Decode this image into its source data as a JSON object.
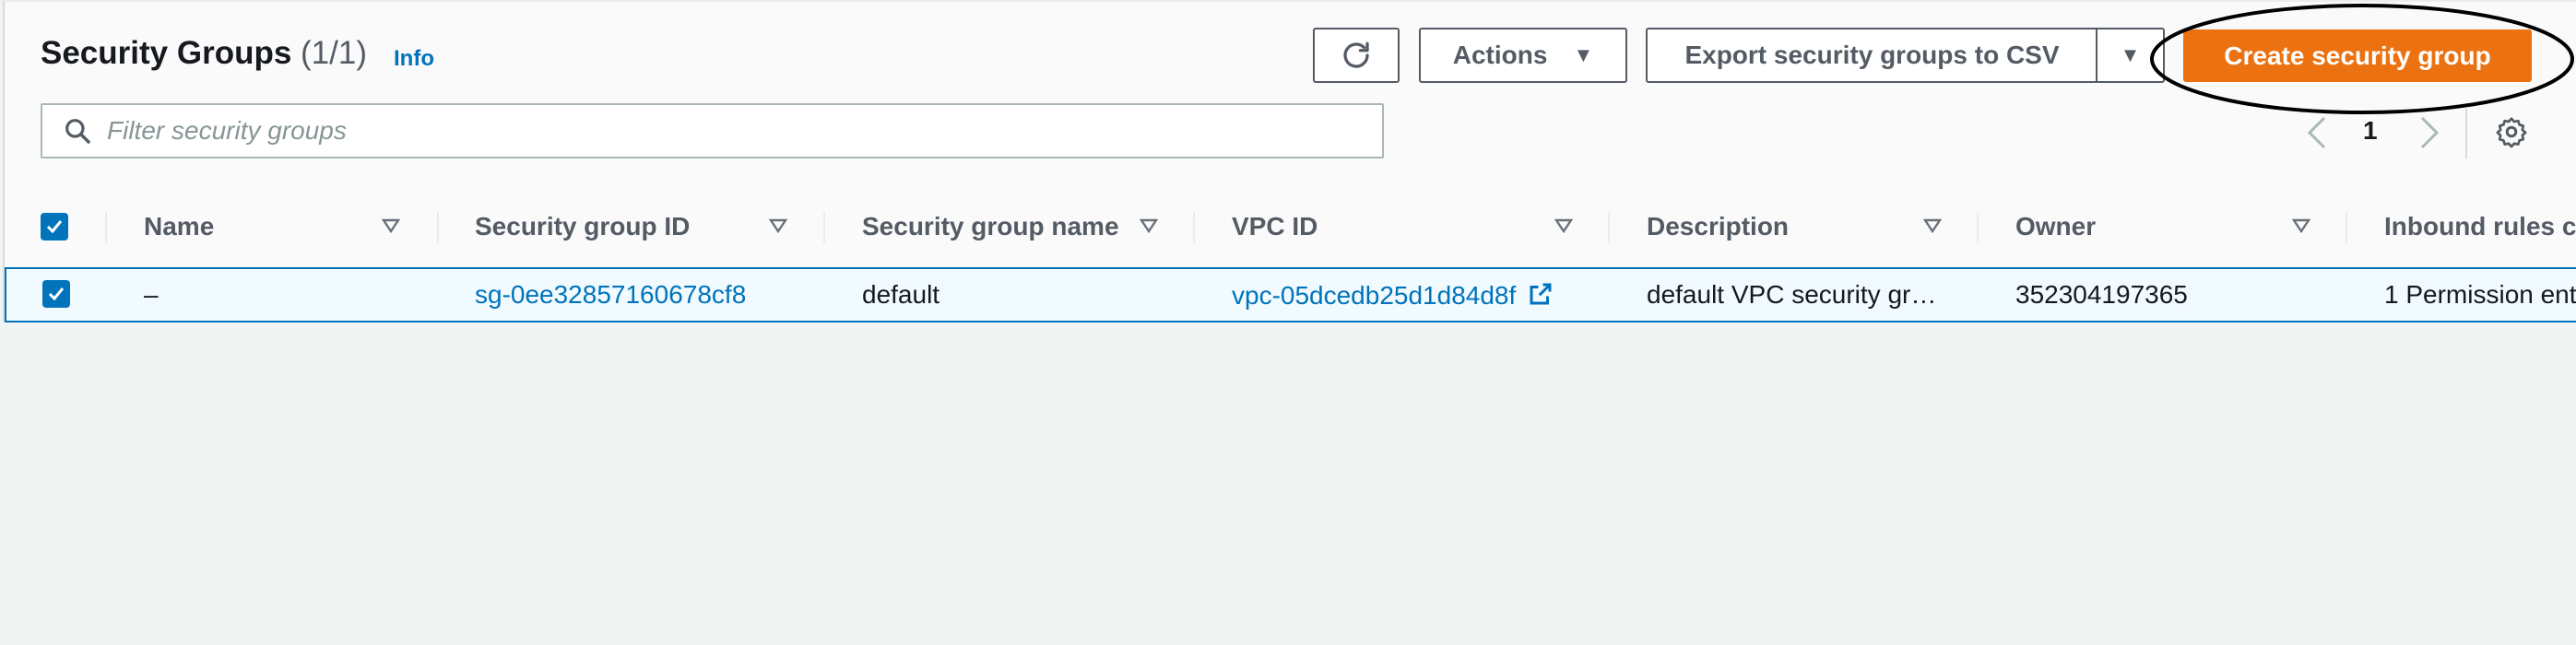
{
  "header": {
    "title": "Security Groups",
    "count": "(1/1)",
    "info_label": "Info"
  },
  "toolbar": {
    "refresh_icon": "refresh-icon",
    "actions_label": "Actions",
    "export_label": "Export security groups to CSV",
    "create_label": "Create security group"
  },
  "search": {
    "placeholder": "Filter security groups",
    "value": ""
  },
  "pagination": {
    "current_page": "1"
  },
  "table": {
    "columns": [
      {
        "label": "Name"
      },
      {
        "label": "Security group ID"
      },
      {
        "label": "Security group name"
      },
      {
        "label": "VPC ID"
      },
      {
        "label": "Description"
      },
      {
        "label": "Owner"
      },
      {
        "label": "Inbound rules c"
      }
    ],
    "rows": [
      {
        "selected": true,
        "name": "–",
        "security_group_id": "sg-0ee32857160678cf8",
        "security_group_name": "default",
        "vpc_id": "vpc-05dcedb25d1d84d8f",
        "description": "default VPC security gr…",
        "owner": "352304197365",
        "inbound_rules": "1 Permission ent"
      }
    ]
  },
  "colors": {
    "primary_button": "#ec7211",
    "link": "#0073bb",
    "selected_row_bg": "#f1faff",
    "text_secondary": "#545b64"
  }
}
